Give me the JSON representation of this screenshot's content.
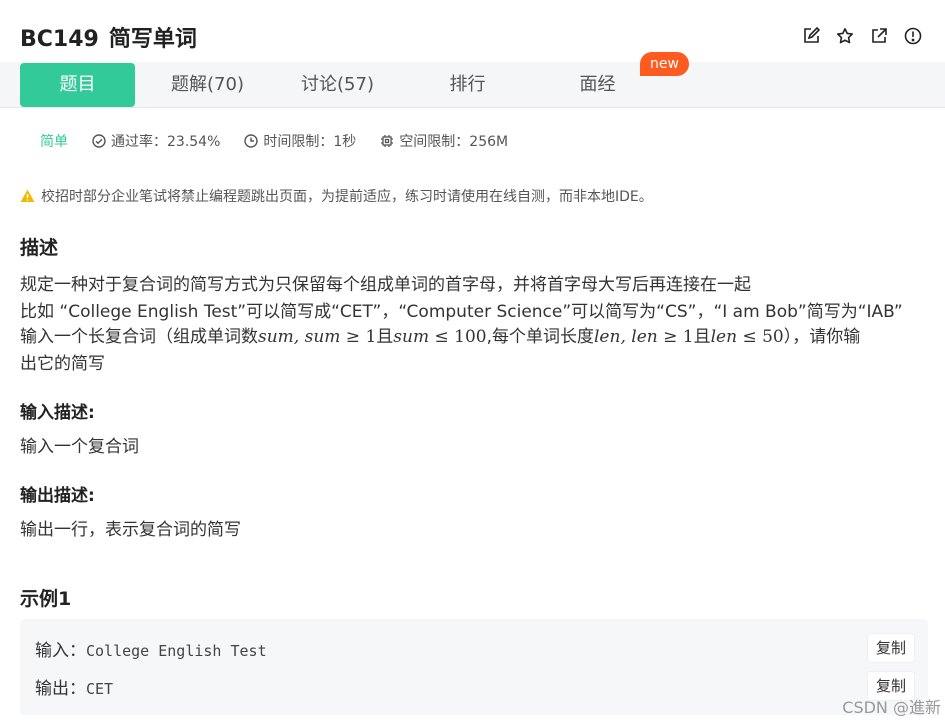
{
  "header": {
    "code": "BC149",
    "name": "简写单词",
    "icons": [
      "edit-icon",
      "star-icon",
      "external-link-icon",
      "info-icon"
    ]
  },
  "tabs": [
    {
      "label": "题目",
      "active": true
    },
    {
      "label": "题解(70)",
      "active": false
    },
    {
      "label": "讨论(57)",
      "active": false
    },
    {
      "label": "排行",
      "active": false
    },
    {
      "label": "面经",
      "active": false,
      "badge": "new"
    }
  ],
  "meta": {
    "difficulty": "简单",
    "pass_rate": "通过率：23.54%",
    "time_limit": "时间限制：1秒",
    "memory_limit": "空间限制：256M"
  },
  "notice": "校招时部分企业笔试将禁止编程题跳出页面，为提前适应，练习时请使用在线自测，而非本地IDE。",
  "description": {
    "heading": "描述",
    "line1": "规定一种对于复合词的简写方式为只保留每个组成单词的首字母，并将首字母大写后再连接在一起",
    "line2": "比如 “College English Test”可以简写成“CET”，“Computer Science”可以简写为“CS”，“I am Bob”简写为“IAB”",
    "line3": {
      "pre": "输入一个长复合词（组成单词数",
      "m1": "sum, sum ≥ ",
      "n1": "1",
      "qie1": "且",
      "m2": "sum ≤ ",
      "n2": "100",
      "mid": ",每个单词长度",
      "m3": "len, len ≥ ",
      "n3": "1",
      "qie2": "且",
      "m4": "len ≤ ",
      "n4": "50",
      "post": "），请你输"
    },
    "line4": "出它的简写"
  },
  "input_desc": {
    "heading": "输入描述:",
    "text": "输入一个复合词"
  },
  "output_desc": {
    "heading": "输出描述:",
    "text": "输出一行，表示复合词的简写"
  },
  "example": {
    "heading": "示例1",
    "input_label": "输入：",
    "input_value": "College English Test",
    "output_label": "输出：",
    "output_value": "CET",
    "copy_label": "复制"
  },
  "watermark": "CSDN @進新",
  "colors": {
    "accent": "#32ca99",
    "badge": "#ff5a1f",
    "warning": "#f5b800"
  }
}
